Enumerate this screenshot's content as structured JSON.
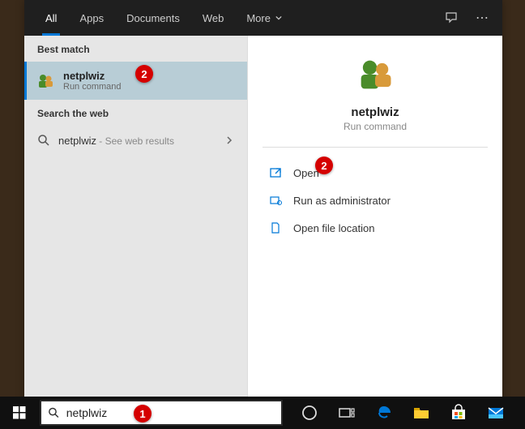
{
  "tabs": {
    "all": "All",
    "apps": "Apps",
    "documents": "Documents",
    "web": "Web",
    "more": "More"
  },
  "sections": {
    "best_match": "Best match",
    "search_web": "Search the web"
  },
  "result": {
    "title": "netplwiz",
    "subtitle": "Run command"
  },
  "web_result": {
    "query": "netplwiz",
    "suffix": " - See web results"
  },
  "detail": {
    "title": "netplwiz",
    "subtitle": "Run command"
  },
  "actions": {
    "open": "Open",
    "run_admin": "Run as administrator",
    "open_loc": "Open file location"
  },
  "search": {
    "value": "netplwiz"
  },
  "annotations": {
    "b1": "1",
    "b2": "2",
    "b3": "2"
  }
}
